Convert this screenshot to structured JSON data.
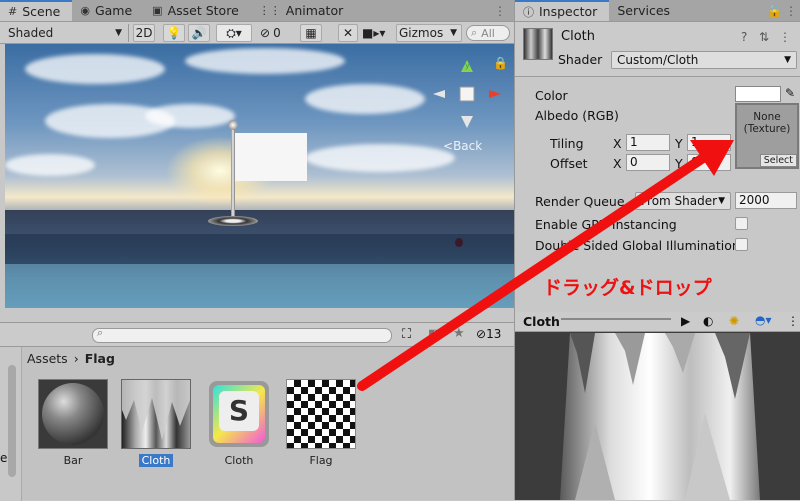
{
  "scene_tabs": [
    {
      "label": "Scene",
      "icon": "hash-icon"
    },
    {
      "label": "Game",
      "icon": "gamepad-icon"
    },
    {
      "label": "Asset Store",
      "icon": "store-icon"
    },
    {
      "label": "Animator",
      "icon": "animator-icon"
    }
  ],
  "scene_toolbar": {
    "shading_mode": "Shaded",
    "mode_2d": "2D",
    "hidden_count": "0",
    "gizmos_label": "Gizmos",
    "search_placeholder": "All"
  },
  "viewport": {
    "back_label": "Back",
    "gizmo_axis_y": "y"
  },
  "project": {
    "breadcrumb": [
      "Assets",
      "Flag"
    ],
    "hidden_count": "13",
    "left_cutoff_label": "er",
    "assets": [
      {
        "label": "Bar",
        "type": "material-sphere",
        "selected": false
      },
      {
        "label": "Cloth",
        "type": "cloth-texture",
        "selected": true
      },
      {
        "label": "Cloth",
        "type": "shader",
        "selected": false
      },
      {
        "label": "Flag",
        "type": "checker-texture",
        "selected": false
      }
    ],
    "shader_letter": "S"
  },
  "inspector": {
    "tabs": [
      "Inspector",
      "Services"
    ],
    "object_name": "Cloth",
    "shader_label": "Shader",
    "shader_value": "Custom/Cloth",
    "color_label": "Color",
    "albedo_label": "Albedo (RGB)",
    "tiling_label": "Tiling",
    "offset_label": "Offset",
    "tiling_x": "1",
    "tiling_y": "1",
    "offset_x": "0",
    "offset_y": "0",
    "axis_x": "X",
    "axis_y": "Y",
    "texture_slot_text_1": "None",
    "texture_slot_text_2": "(Texture)",
    "texture_select": "Select",
    "render_queue_label": "Render Queue",
    "render_queue_mode": "From Shader",
    "render_queue_value": "2000",
    "gpu_instancing_label": "Enable GPU Instancing",
    "double_sided_label": "Double Sided Global Illumination"
  },
  "preview": {
    "title": "Cloth"
  },
  "annotation": {
    "text": "ドラッグ&ドロップ",
    "color": "#e11111"
  },
  "colors": {
    "accent": "#3a78c8",
    "panel_bg": "#c8c8c8",
    "arrow": "#f01010"
  }
}
